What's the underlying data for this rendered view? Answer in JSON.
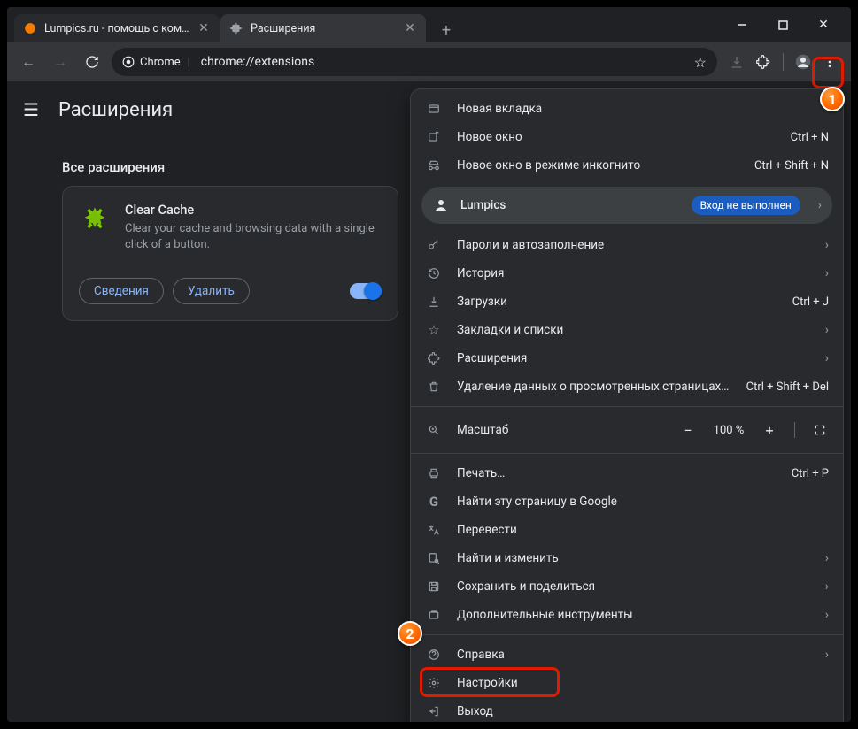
{
  "tabs": [
    {
      "title": "Lumpics.ru - помощь с компью"
    },
    {
      "title": "Расширения"
    }
  ],
  "toolbar": {
    "chip": "Chrome",
    "url": "chrome://extensions"
  },
  "page": {
    "title": "Расширения",
    "section_title": "Все расширения",
    "extension": {
      "name": "Clear Cache",
      "desc": "Clear your cache and browsing data with a single click of a button.",
      "details": "Сведения",
      "remove": "Удалить"
    }
  },
  "menu": {
    "new_tab": "Новая вкладка",
    "new_window": "Новое окно",
    "new_window_sc": "Ctrl + N",
    "incognito": "Новое окно в режиме инкогнито",
    "incognito_sc": "Ctrl + Shift + N",
    "profile_name": "Lumpics",
    "profile_chip": "Вход не выполнен",
    "passwords": "Пароли и автозаполнение",
    "history": "История",
    "downloads": "Загрузки",
    "downloads_sc": "Ctrl + J",
    "bookmarks": "Закладки и списки",
    "extensions": "Расширения",
    "clear_data": "Удаление данных о просмотренных страницах…",
    "clear_data_sc": "Ctrl + Shift + Del",
    "zoom_label": "Масштаб",
    "zoom_value": "100 %",
    "print": "Печать…",
    "print_sc": "Ctrl + P",
    "google_search": "Найти эту страницу в Google",
    "translate": "Перевести",
    "find_edit": "Найти и изменить",
    "save_share": "Сохранить и поделиться",
    "more_tools": "Дополнительные инструменты",
    "help": "Справка",
    "settings": "Настройки",
    "exit": "Выход"
  },
  "annotations": {
    "one": "1",
    "two": "2"
  }
}
